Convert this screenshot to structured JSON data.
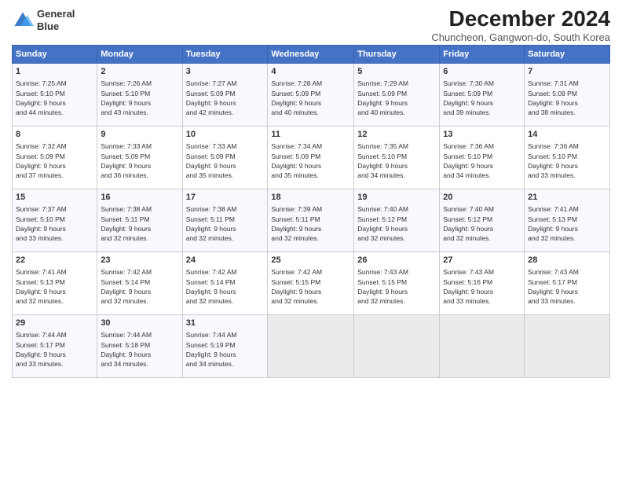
{
  "logo": {
    "line1": "General",
    "line2": "Blue"
  },
  "title": "December 2024",
  "subtitle": "Chuncheon, Gangwon-do, South Korea",
  "days_of_week": [
    "Sunday",
    "Monday",
    "Tuesday",
    "Wednesday",
    "Thursday",
    "Friday",
    "Saturday"
  ],
  "weeks": [
    [
      {
        "day": "1",
        "info": "Sunrise: 7:25 AM\nSunset: 5:10 PM\nDaylight: 9 hours\nand 44 minutes."
      },
      {
        "day": "2",
        "info": "Sunrise: 7:26 AM\nSunset: 5:10 PM\nDaylight: 9 hours\nand 43 minutes."
      },
      {
        "day": "3",
        "info": "Sunrise: 7:27 AM\nSunset: 5:09 PM\nDaylight: 9 hours\nand 42 minutes."
      },
      {
        "day": "4",
        "info": "Sunrise: 7:28 AM\nSunset: 5:09 PM\nDaylight: 9 hours\nand 40 minutes."
      },
      {
        "day": "5",
        "info": "Sunrise: 7:29 AM\nSunset: 5:09 PM\nDaylight: 9 hours\nand 40 minutes."
      },
      {
        "day": "6",
        "info": "Sunrise: 7:30 AM\nSunset: 5:09 PM\nDaylight: 9 hours\nand 39 minutes."
      },
      {
        "day": "7",
        "info": "Sunrise: 7:31 AM\nSunset: 5:09 PM\nDaylight: 9 hours\nand 38 minutes."
      }
    ],
    [
      {
        "day": "8",
        "info": "Sunrise: 7:32 AM\nSunset: 5:09 PM\nDaylight: 9 hours\nand 37 minutes."
      },
      {
        "day": "9",
        "info": "Sunrise: 7:33 AM\nSunset: 5:09 PM\nDaylight: 9 hours\nand 36 minutes."
      },
      {
        "day": "10",
        "info": "Sunrise: 7:33 AM\nSunset: 5:09 PM\nDaylight: 9 hours\nand 35 minutes."
      },
      {
        "day": "11",
        "info": "Sunrise: 7:34 AM\nSunset: 5:09 PM\nDaylight: 9 hours\nand 35 minutes."
      },
      {
        "day": "12",
        "info": "Sunrise: 7:35 AM\nSunset: 5:10 PM\nDaylight: 9 hours\nand 34 minutes."
      },
      {
        "day": "13",
        "info": "Sunrise: 7:36 AM\nSunset: 5:10 PM\nDaylight: 9 hours\nand 34 minutes."
      },
      {
        "day": "14",
        "info": "Sunrise: 7:36 AM\nSunset: 5:10 PM\nDaylight: 9 hours\nand 33 minutes."
      }
    ],
    [
      {
        "day": "15",
        "info": "Sunrise: 7:37 AM\nSunset: 5:10 PM\nDaylight: 9 hours\nand 33 minutes."
      },
      {
        "day": "16",
        "info": "Sunrise: 7:38 AM\nSunset: 5:11 PM\nDaylight: 9 hours\nand 32 minutes."
      },
      {
        "day": "17",
        "info": "Sunrise: 7:38 AM\nSunset: 5:11 PM\nDaylight: 9 hours\nand 32 minutes."
      },
      {
        "day": "18",
        "info": "Sunrise: 7:39 AM\nSunset: 5:11 PM\nDaylight: 9 hours\nand 32 minutes."
      },
      {
        "day": "19",
        "info": "Sunrise: 7:40 AM\nSunset: 5:12 PM\nDaylight: 9 hours\nand 32 minutes."
      },
      {
        "day": "20",
        "info": "Sunrise: 7:40 AM\nSunset: 5:12 PM\nDaylight: 9 hours\nand 32 minutes."
      },
      {
        "day": "21",
        "info": "Sunrise: 7:41 AM\nSunset: 5:13 PM\nDaylight: 9 hours\nand 32 minutes."
      }
    ],
    [
      {
        "day": "22",
        "info": "Sunrise: 7:41 AM\nSunset: 5:13 PM\nDaylight: 9 hours\nand 32 minutes."
      },
      {
        "day": "23",
        "info": "Sunrise: 7:42 AM\nSunset: 5:14 PM\nDaylight: 9 hours\nand 32 minutes."
      },
      {
        "day": "24",
        "info": "Sunrise: 7:42 AM\nSunset: 5:14 PM\nDaylight: 9 hours\nand 32 minutes."
      },
      {
        "day": "25",
        "info": "Sunrise: 7:42 AM\nSunset: 5:15 PM\nDaylight: 9 hours\nand 32 minutes."
      },
      {
        "day": "26",
        "info": "Sunrise: 7:43 AM\nSunset: 5:15 PM\nDaylight: 9 hours\nand 32 minutes."
      },
      {
        "day": "27",
        "info": "Sunrise: 7:43 AM\nSunset: 5:16 PM\nDaylight: 9 hours\nand 33 minutes."
      },
      {
        "day": "28",
        "info": "Sunrise: 7:43 AM\nSunset: 5:17 PM\nDaylight: 9 hours\nand 33 minutes."
      }
    ],
    [
      {
        "day": "29",
        "info": "Sunrise: 7:44 AM\nSunset: 5:17 PM\nDaylight: 9 hours\nand 33 minutes."
      },
      {
        "day": "30",
        "info": "Sunrise: 7:44 AM\nSunset: 5:18 PM\nDaylight: 9 hours\nand 34 minutes."
      },
      {
        "day": "31",
        "info": "Sunrise: 7:44 AM\nSunset: 5:19 PM\nDaylight: 9 hours\nand 34 minutes."
      },
      {
        "day": "",
        "info": ""
      },
      {
        "day": "",
        "info": ""
      },
      {
        "day": "",
        "info": ""
      },
      {
        "day": "",
        "info": ""
      }
    ]
  ]
}
